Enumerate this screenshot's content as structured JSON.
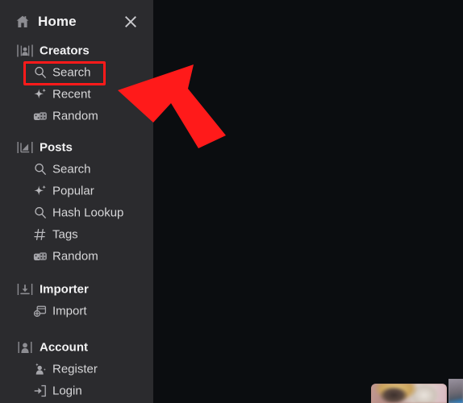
{
  "header": {
    "home_label": "Home",
    "home_icon": "house-icon",
    "close_icon": "close-icon"
  },
  "sidebar": {
    "background_color": "#2b2b2e",
    "text_color": "#d6d6d8",
    "groups": [
      {
        "id": "creators",
        "label": "Creators",
        "icon": "creators-portrait-icon",
        "items": [
          {
            "label": "Search",
            "icon": "magnifier-icon",
            "highlighted": true
          },
          {
            "label": "Recent",
            "icon": "sparkle-icon",
            "highlighted": false
          },
          {
            "label": "Random",
            "icon": "dice-icon",
            "highlighted": false
          }
        ]
      },
      {
        "id": "posts",
        "label": "Posts",
        "icon": "posts-chart-icon",
        "items": [
          {
            "label": "Search",
            "icon": "magnifier-icon",
            "highlighted": false
          },
          {
            "label": "Popular",
            "icon": "sparkle-icon",
            "highlighted": false
          },
          {
            "label": "Hash Lookup",
            "icon": "magnifier-icon",
            "highlighted": false
          },
          {
            "label": "Tags",
            "icon": "hash-icon",
            "highlighted": false
          },
          {
            "label": "Random",
            "icon": "dice-icon",
            "highlighted": false
          }
        ]
      },
      {
        "id": "importer",
        "label": "Importer",
        "icon": "import-arrow-icon",
        "items": [
          {
            "label": "Import",
            "icon": "add-window-icon",
            "highlighted": false
          }
        ]
      },
      {
        "id": "account",
        "label": "Account",
        "icon": "person-icon",
        "items": [
          {
            "label": "Register",
            "icon": "person-add-icon",
            "highlighted": false
          },
          {
            "label": "Login",
            "icon": "login-door-icon",
            "highlighted": false
          }
        ]
      }
    ]
  },
  "annotation": {
    "highlight_color": "#ff1a1a",
    "arrow_color": "#ff1a1a",
    "arrow_icon": "pointer-arrow-icon",
    "target_label": "Search"
  },
  "main": {
    "background_color": "#0b0d10",
    "thumbnails": [
      {
        "id": "thumb-portrait",
        "icon": "image-thumbnail"
      },
      {
        "id": "thumb-edge",
        "icon": "image-thumbnail"
      }
    ]
  }
}
